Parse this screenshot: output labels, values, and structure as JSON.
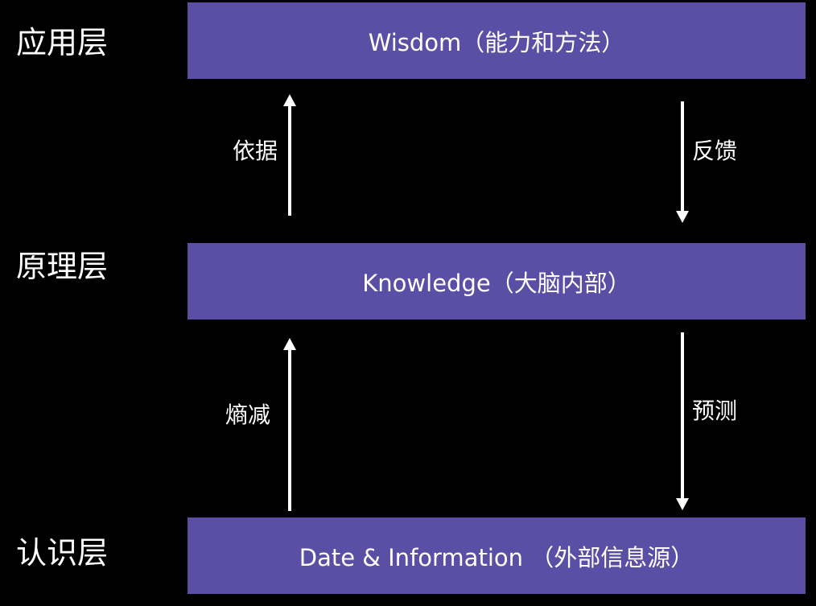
{
  "layers": {
    "top": "应用层",
    "middle": "原理层",
    "bottom": "认识层"
  },
  "boxes": {
    "top": "Wisdom（能力和方法）",
    "middle": "Knowledge（大脑内部）",
    "bottom": "Date & Information （外部信息源）"
  },
  "edges": {
    "top_up": "依据",
    "top_down": "反馈",
    "bottom_up": "熵减",
    "bottom_down": "预测"
  },
  "colors": {
    "background": "#000000",
    "box_fill": "#5a4fa5",
    "text": "#ffffff",
    "arrow": "#ffffff"
  }
}
